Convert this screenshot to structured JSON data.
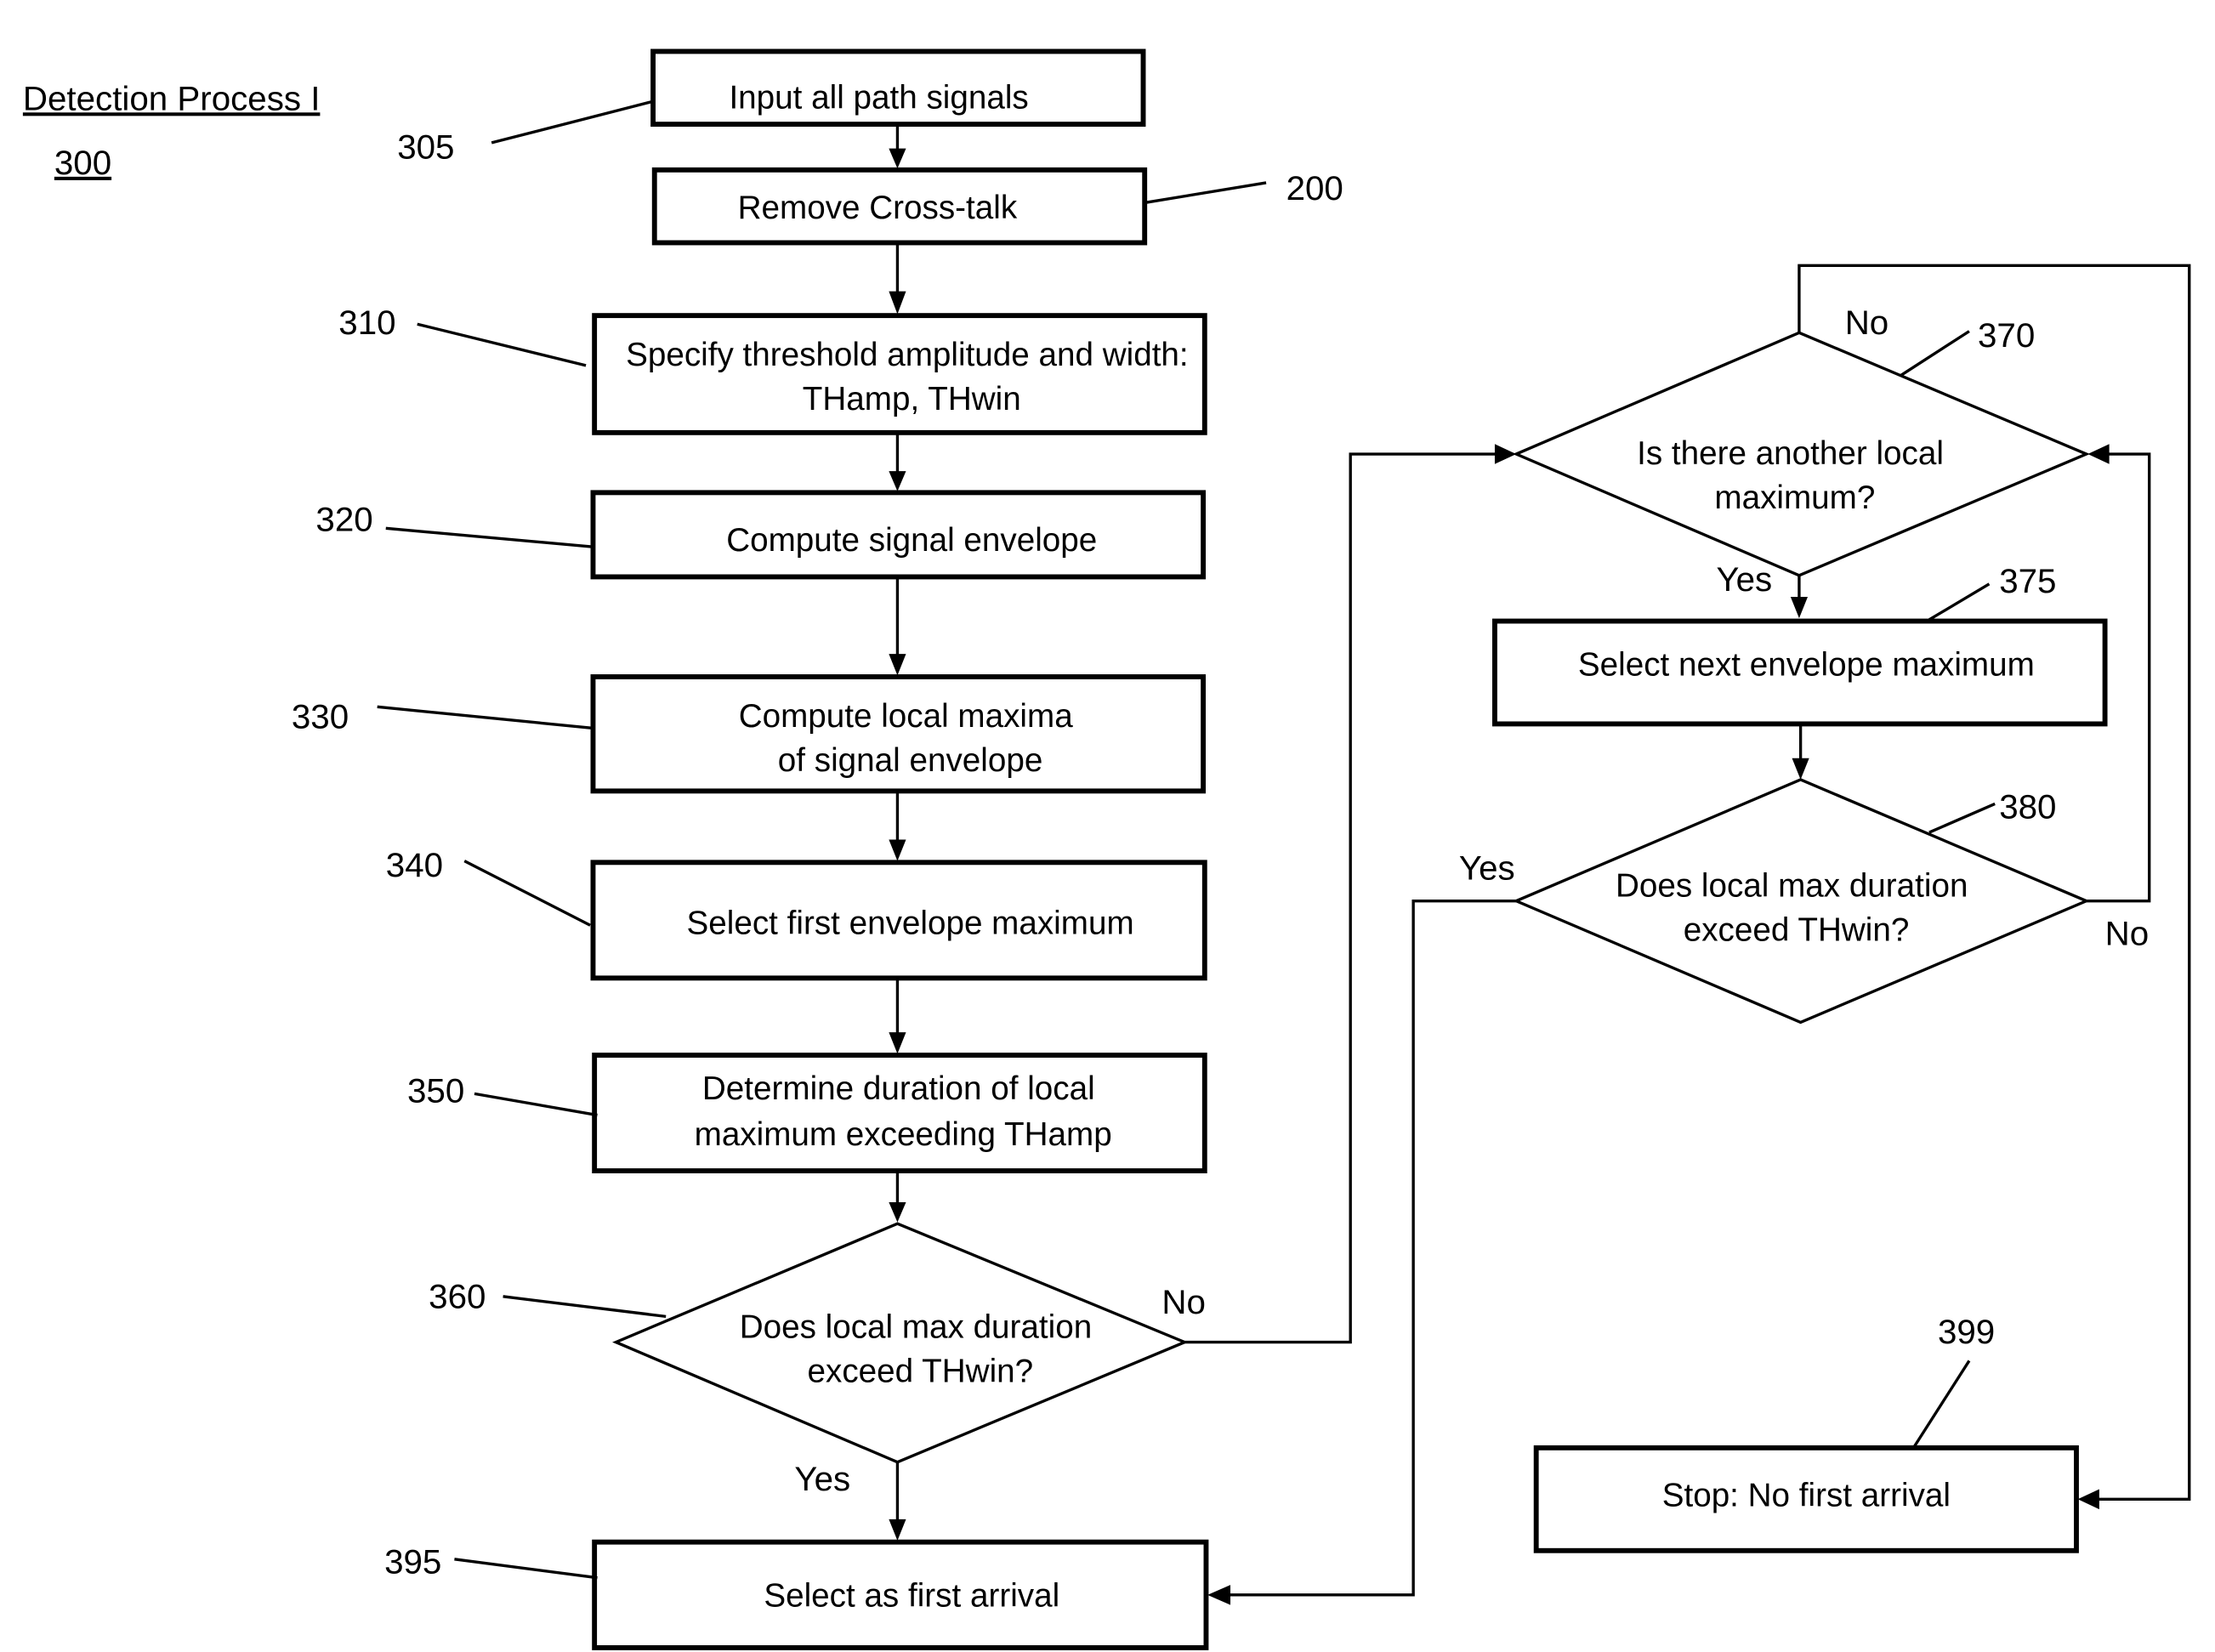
{
  "title": {
    "name": "Detection Process I",
    "number": "300"
  },
  "nodes": {
    "n305": {
      "ref": "305",
      "lines": [
        "Input all path signals"
      ]
    },
    "n200": {
      "ref": "200",
      "lines": [
        "Remove Cross-talk"
      ]
    },
    "n310": {
      "ref": "310",
      "lines": [
        "Specify threshold amplitude and width:",
        "THamp, THwin"
      ]
    },
    "n320": {
      "ref": "320",
      "lines": [
        "Compute signal envelope"
      ]
    },
    "n330": {
      "ref": "330",
      "lines": [
        "Compute local maxima",
        "of signal envelope"
      ]
    },
    "n340": {
      "ref": "340",
      "lines": [
        "Select first envelope maximum"
      ]
    },
    "n350": {
      "ref": "350",
      "lines": [
        "Determine duration of local",
        "maximum exceeding THamp"
      ]
    },
    "n360": {
      "ref": "360",
      "lines": [
        "Does local max duration",
        "exceed THwin?"
      ]
    },
    "n395": {
      "ref": "395",
      "lines": [
        "Select as first arrival"
      ]
    },
    "n370": {
      "ref": "370",
      "lines": [
        "Is there another local",
        "maximum?"
      ]
    },
    "n375": {
      "ref": "375",
      "lines": [
        "Select next envelope maximum"
      ]
    },
    "n380": {
      "ref": "380",
      "lines": [
        "Does local max duration",
        "exceed THwin?"
      ]
    },
    "n399": {
      "ref": "399",
      "lines": [
        "Stop:  No first arrival"
      ]
    }
  },
  "branches": {
    "n360_no": "No",
    "n360_yes": "Yes",
    "n370_no": "No",
    "n370_yes": "Yes",
    "n380_yes": "Yes",
    "n380_no": "No"
  }
}
